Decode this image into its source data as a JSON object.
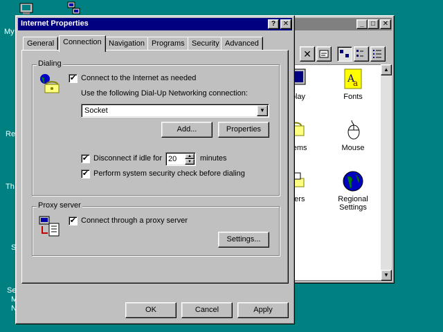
{
  "desktop": {
    "icon_labels": [
      "My",
      "Re",
      "Th",
      "S",
      "Se",
      "M",
      "N"
    ]
  },
  "control_panel": {
    "items": [
      {
        "label": "isplay",
        "icon": "display-icon"
      },
      {
        "label": "Fonts",
        "icon": "fonts-icon"
      },
      {
        "label": "odems",
        "icon": "modems-icon"
      },
      {
        "label": "Mouse",
        "icon": "mouse-icon"
      },
      {
        "label": "inters",
        "icon": "printers-icon"
      },
      {
        "label": "Regional",
        "icon": "globe-icon"
      },
      {
        "label": "Settings",
        "icon": "globe-icon"
      }
    ]
  },
  "dialog": {
    "title": "Internet Properties",
    "title_help": "?",
    "title_close": "✕",
    "tabs": [
      "General",
      "Connection",
      "Navigation",
      "Programs",
      "Security",
      "Advanced"
    ],
    "active_tab": "Connection",
    "dialing": {
      "group_label": "Dialing",
      "connect_checkbox": {
        "label": "Connect to the Internet as needed",
        "checked": true,
        "mark": "✔"
      },
      "dun_label": "Use the following Dial-Up Networking connection:",
      "dun_value": "Socket",
      "add_button": "Add...",
      "properties_button": "Properties",
      "disconnect_label": "Disconnect if idle for",
      "disconnect_checked": true,
      "idle_value": "20",
      "idle_units": "minutes",
      "security_label": "Perform system security check before dialing",
      "security_checked": true,
      "check_mark": "✔"
    },
    "proxy": {
      "group_label": "Proxy server",
      "proxy_checkbox_label": "Connect through a proxy server",
      "proxy_checked": true,
      "check_mark": "✔",
      "settings_button": "Settings..."
    },
    "buttons": {
      "ok": "OK",
      "cancel": "Cancel",
      "apply": "Apply"
    }
  },
  "colors": {
    "desktop": "#008080",
    "face": "#c0c0c0",
    "active_title": "#000080",
    "inactive_title": "#808080"
  }
}
